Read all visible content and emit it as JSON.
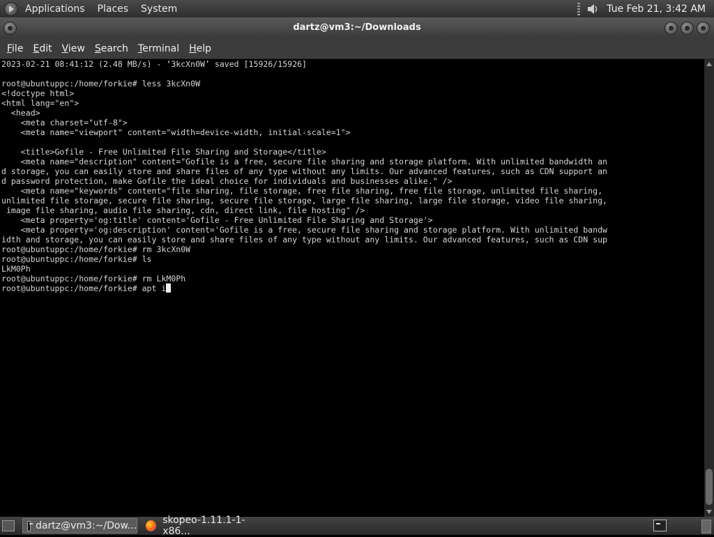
{
  "top_panel": {
    "menus": [
      "Applications",
      "Places",
      "System"
    ],
    "clock": "Tue Feb 21,  3:42 AM",
    "icons": {
      "logo": "gnome-foot-icon",
      "volume": "speaker-volume-icon"
    }
  },
  "window": {
    "title": "dartz@vm3:~/Downloads"
  },
  "menubar": {
    "items": [
      "File",
      "Edit",
      "View",
      "Search",
      "Terminal",
      "Help"
    ]
  },
  "terminal": {
    "lines": [
      "2023-02-21 08:41:12 (2.48 MB/s) - ‘3kcXn0W’ saved [15926/15926]",
      "",
      "root@ubuntuppc:/home/forkie# less 3kcXn0W",
      "<!doctype html>",
      "<html lang=\"en\">",
      "  <head>",
      "    <meta charset=\"utf-8\">",
      "    <meta name=\"viewport\" content=\"width=device-width, initial-scale=1\">",
      "",
      "    <title>Gofile - Free Unlimited File Sharing and Storage</title>",
      "    <meta name=\"description\" content=\"Gofile is a free, secure file sharing and storage platform. With unlimited bandwidth an",
      "d storage, you can easily store and share files of any type without any limits. Our advanced features, such as CDN support an",
      "d password protection, make Gofile the ideal choice for individuals and businesses alike.\" />",
      "    <meta name=\"keywords\" content=\"file sharing, file storage, free file sharing, free file storage, unlimited file sharing,",
      "unlimited file storage, secure file sharing, secure file storage, large file sharing, large file storage, video file sharing,",
      " image file sharing, audio file sharing, cdn, direct link, file hosting\" />",
      "    <meta property='og:title' content='Gofile - Free Unlimited File Sharing and Storage'>",
      "    <meta property='og:description' content='Gofile is a free, secure file sharing and storage platform. With unlimited bandw",
      "idth and storage, you can easily store and share files of any type without any limits. Our advanced features, such as CDN sup",
      "root@ubuntuppc:/home/forkie# rm 3kcXn0W",
      "root@ubuntuppc:/home/forkie# ls",
      "LkM0Ph",
      "root@ubuntuppc:/home/forkie# rm LkM0Ph"
    ],
    "current_prompt": "root@ubuntuppc:/home/forkie# apt i"
  },
  "taskbar": {
    "tasks": [
      {
        "label": "dartz@vm3:~/Dow...",
        "icon": "terminal-icon"
      },
      {
        "label": "skopeo-1.11.1-1-x86...",
        "icon": "firefox-icon"
      }
    ]
  }
}
